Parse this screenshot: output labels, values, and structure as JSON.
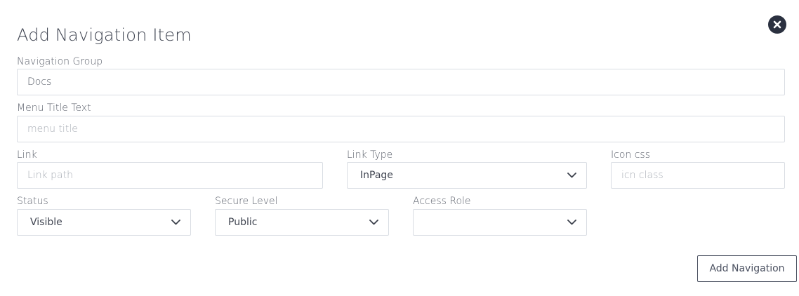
{
  "dialog": {
    "title": "Add Navigation Item",
    "close_icon": "close-circle-icon"
  },
  "fields": {
    "navigation_group": {
      "label": "Navigation Group",
      "value": "Docs",
      "placeholder": ""
    },
    "menu_title": {
      "label": "Menu Title Text",
      "value": "",
      "placeholder": "menu title"
    },
    "link": {
      "label": "Link",
      "value": "",
      "placeholder": "Link path"
    },
    "link_type": {
      "label": "Link Type",
      "selected": "InPage"
    },
    "icon_css": {
      "label": "Icon css",
      "value": "",
      "placeholder": "icn class"
    },
    "status": {
      "label": "Status",
      "selected": "Visible"
    },
    "secure_level": {
      "label": "Secure Level",
      "selected": "Public"
    },
    "access_role": {
      "label": "Access Role",
      "selected": ""
    }
  },
  "actions": {
    "submit_label": "Add Navigation"
  },
  "colors": {
    "text": "#444a55",
    "border": "#d9dde3",
    "close_icon_bg": "#2b3140",
    "button_border": "#4a5060"
  }
}
